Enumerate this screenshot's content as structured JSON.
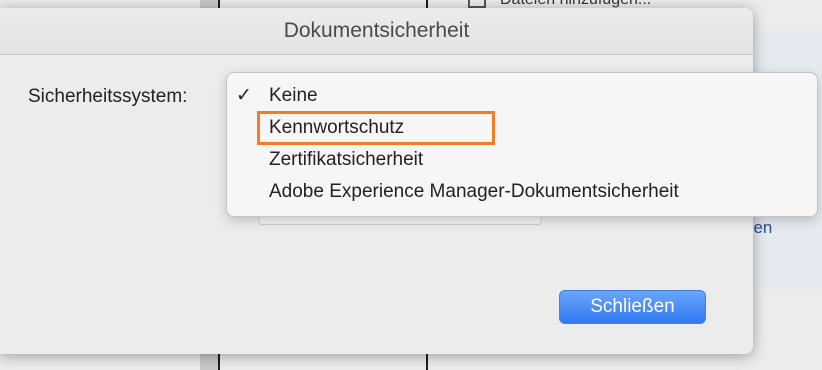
{
  "background": {
    "top_text": "Dateien hinzufügen...",
    "right_text_1": "ben",
    "right_text_2": "g"
  },
  "dialog": {
    "title": "Dokumentsicherheit",
    "security_label": "Sicherheitssystem:",
    "close_label": "Schließen"
  },
  "menu": {
    "checkmark": "✓",
    "items": [
      {
        "label": "Keine",
        "selected": true
      },
      {
        "label": "Kennwortschutz",
        "highlighted": true
      },
      {
        "label": "Zertifikatsicherheit"
      },
      {
        "label": "Adobe Experience Manager-Dokumentsicherheit"
      }
    ]
  },
  "colors": {
    "highlight_border": "#f57c22",
    "button_blue": "#2f78f0"
  }
}
